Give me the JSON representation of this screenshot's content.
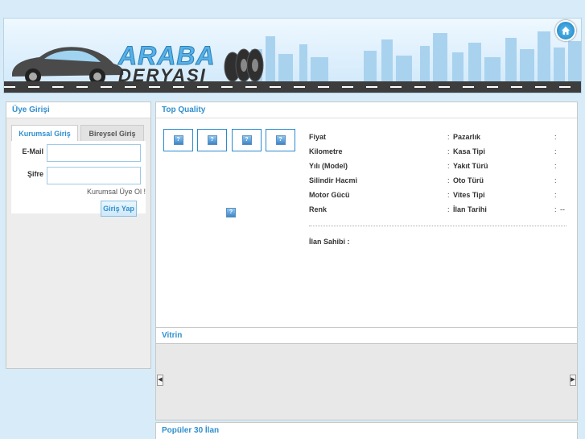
{
  "header": {
    "logo_top": "ARABA",
    "logo_bottom": "DERYASI",
    "home_icon": "home-icon"
  },
  "login": {
    "title": "Üye Girişi",
    "tabs": [
      {
        "label": "Kurumsal Giriş",
        "active": true
      },
      {
        "label": "Bireysel Giriş",
        "active": false
      }
    ],
    "email_label": "E-Mail",
    "password_label": "Şifre",
    "email_value": "",
    "password_value": "",
    "register_link": "Kurumsal Üye Ol !",
    "login_button": "Giriş Yap"
  },
  "quality": {
    "title": "Top Quality",
    "thumbnail_icon": "broken-image-icon",
    "specs_left": [
      "Fiyat",
      "Kilometre",
      "Yılı (Model)",
      "Silindir Hacmi",
      "Motor Gücü",
      "Renk"
    ],
    "specs_right": [
      "Pazarlık",
      "Kasa Tipi",
      "Yakıt Türü",
      "Oto Türü",
      "Vites Tipi",
      "İlan Tarihi"
    ],
    "last_value": "--",
    "owner_label": "İlan Sahibi :"
  },
  "vitrin": {
    "title": "Vitrin"
  },
  "popular": {
    "title": "Popüler 30 İlan"
  },
  "colors": {
    "accent": "#2f8fcf",
    "background": "#d7ecf8",
    "panel": "#ededed"
  }
}
